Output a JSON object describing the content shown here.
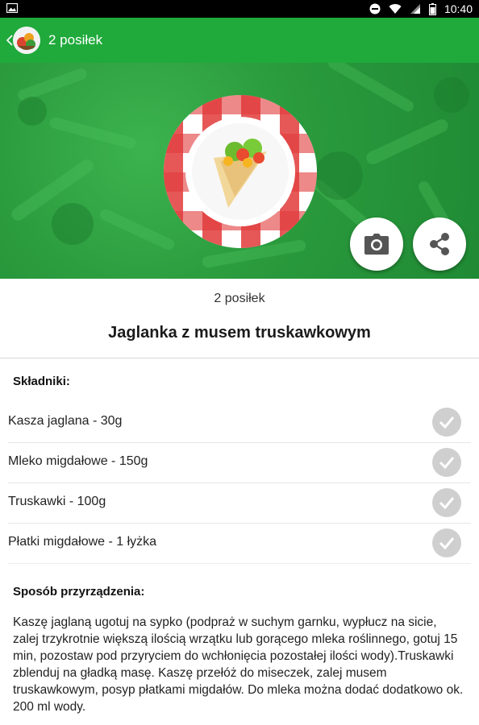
{
  "status_bar": {
    "time": "10:40",
    "icons": [
      "image-icon",
      "minus-circle-icon",
      "wifi-icon",
      "signal-icon",
      "battery-icon"
    ]
  },
  "app_bar": {
    "title": "2 posiłek",
    "back_icon": "chevron-left-icon",
    "logo_icon": "app-logo-icon",
    "color": "#1faa3b"
  },
  "hero": {
    "image": "tortilla-wrap-on-checkered-plate",
    "background_color": "#2a9a3d",
    "camera_icon": "camera-icon",
    "share_icon": "share-icon"
  },
  "meal": {
    "label": "2 posiłek",
    "title": "Jaglanka z musem truskawkowym"
  },
  "ingredients": {
    "heading": "Składniki:",
    "items": [
      {
        "label": "Kasza jaglana - 30g",
        "checked": false
      },
      {
        "label": "Mleko migdałowe - 150g",
        "checked": false
      },
      {
        "label": "Truskawki - 100g",
        "checked": false
      },
      {
        "label": "Płatki migdałowe - 1 łyżka",
        "checked": false
      }
    ],
    "check_icon": "check-circle-icon"
  },
  "preparation": {
    "heading": "Sposób przyrządzenia:",
    "text": "Kaszę jaglaną ugotuj na sypko (podpraż w suchym garnku, wypłucz na sicie, zalej trzykrotnie większą ilością wrzątku lub gorącego mleka roślinnego, gotuj 15 min, pozostaw pod przyryciem do wchłonięcia pozostałej ilości wody).Truskawki zblenduj na gładką masę. Kaszę przełóż do miseczek, zalej musem truskawkowym, posyp płatkami migdałów. Do mleka można dodać dodatkowo ok. 200 ml wody."
  }
}
